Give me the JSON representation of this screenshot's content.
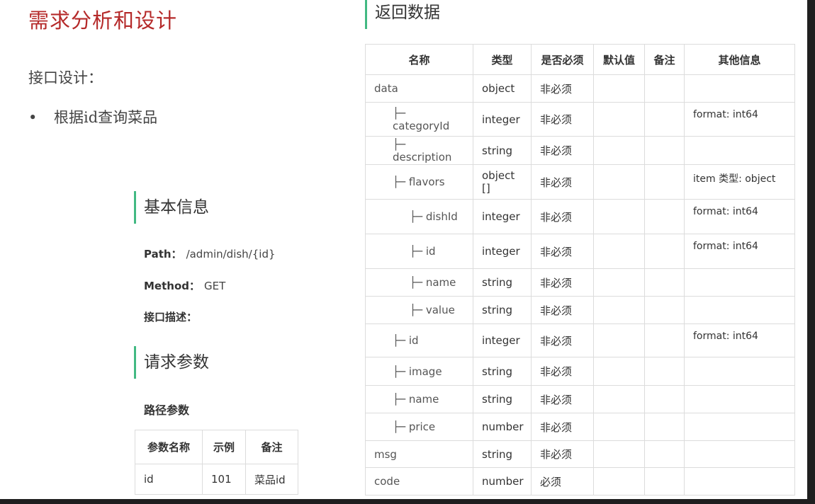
{
  "slide": {
    "title": "需求分析和设计",
    "subtitle": "接口设计：",
    "bullet": "•",
    "bullet_text": "根据id查询菜品"
  },
  "basic_info": {
    "heading": "基本信息",
    "path_key": "Path：",
    "path_value": "/admin/dish/{id}",
    "method_key": "Method：",
    "method_value": "GET",
    "desc_key": "接口描述："
  },
  "request": {
    "heading": "请求参数",
    "path_params_label": "路径参数",
    "headers": [
      "参数名称",
      "示例",
      "备注"
    ],
    "rows": [
      [
        "id",
        "101",
        "菜品id"
      ]
    ]
  },
  "response": {
    "heading": "返回数据",
    "headers": [
      "名称",
      "类型",
      "是否必须",
      "默认值",
      "备注",
      "其他信息"
    ],
    "rows": [
      {
        "name": "data",
        "type": "object",
        "required": "非必须",
        "default": "",
        "note": "",
        "other": "",
        "h": 39
      },
      {
        "name": "├─ categoryId",
        "type": "integer",
        "required": "非必须",
        "default": "",
        "note": "",
        "other": "format: int64",
        "h": 48
      },
      {
        "name": "├─ description",
        "type": "string",
        "required": "非必须",
        "default": "",
        "note": "",
        "other": "",
        "h": 40
      },
      {
        "name": "├─ flavors",
        "type": "object []",
        "required": "非必须",
        "default": "",
        "note": "",
        "other": "item 类型: object",
        "h": 49
      },
      {
        "name": "├─ dishId",
        "type": "integer",
        "required": "非必须",
        "default": "",
        "note": "",
        "other": "format: int64",
        "h": 49
      },
      {
        "name": "├─ id",
        "type": "integer",
        "required": "非必须",
        "default": "",
        "note": "",
        "other": "format: int64",
        "h": 49
      },
      {
        "name": "├─ name",
        "type": "string",
        "required": "非必须",
        "default": "",
        "note": "",
        "other": "",
        "h": 39
      },
      {
        "name": "├─ value",
        "type": "string",
        "required": "非必须",
        "default": "",
        "note": "",
        "other": "",
        "h": 39
      },
      {
        "name": "├─ id",
        "type": "integer",
        "required": "非必须",
        "default": "",
        "note": "",
        "other": "format: int64",
        "h": 47
      },
      {
        "name": "├─ image",
        "type": "string",
        "required": "非必须",
        "default": "",
        "note": "",
        "other": "",
        "h": 40
      },
      {
        "name": "├─ name",
        "type": "string",
        "required": "非必须",
        "default": "",
        "note": "",
        "other": "",
        "h": 39
      },
      {
        "name": "├─ price",
        "type": "number",
        "required": "非必须",
        "default": "",
        "note": "",
        "other": "",
        "h": 39
      },
      {
        "name": "msg",
        "type": "string",
        "required": "非必须",
        "default": "",
        "note": "",
        "other": "",
        "h": 38
      },
      {
        "name": "code",
        "type": "number",
        "required": "必须",
        "default": "",
        "note": "",
        "other": "",
        "h": 39
      }
    ],
    "indent_levels": [
      0,
      1,
      1,
      1,
      2,
      2,
      2,
      2,
      1,
      1,
      1,
      1,
      0,
      0
    ]
  },
  "colors": {
    "title_red": "#b52a2a",
    "accent_green": "#42b983",
    "border_gray": "#dcdcdc"
  }
}
